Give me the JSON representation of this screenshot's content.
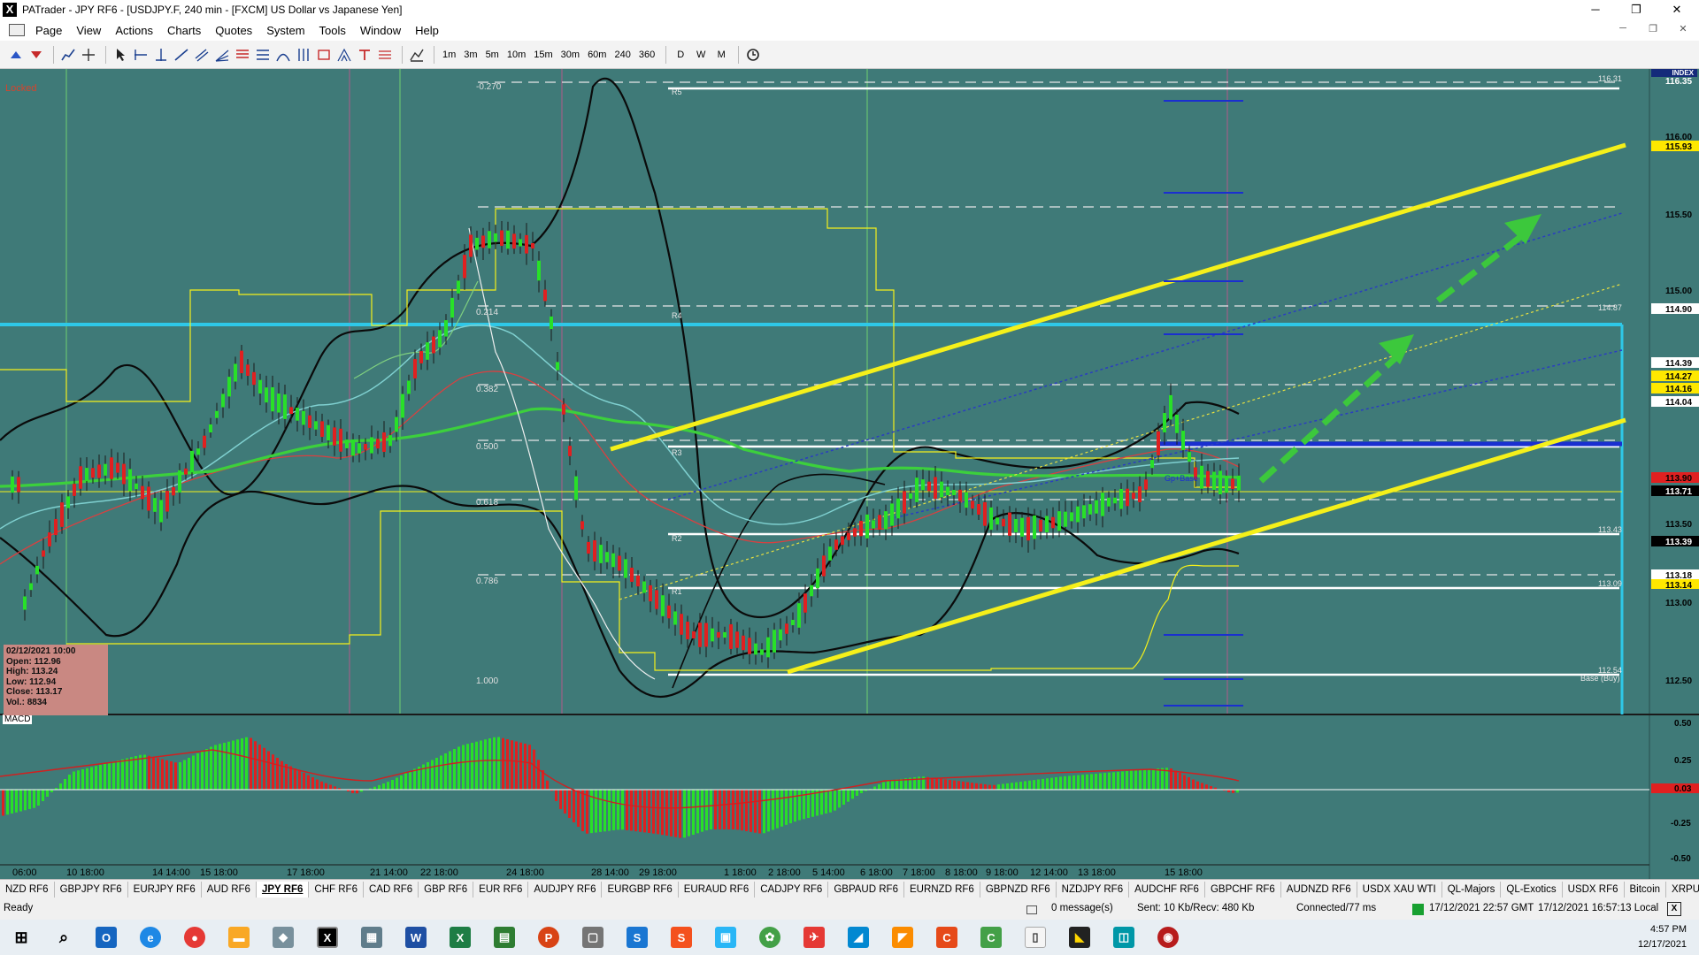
{
  "window": {
    "title": "PATrader - JPY RF6 - [USDJPY.F, 240 min - [FXCM] US Dollar vs Japanese Yen]",
    "minimize_glyph": "─",
    "maximize_glyph": "❐",
    "close_glyph": "✕"
  },
  "menu": [
    "Page",
    "View",
    "Actions",
    "Charts",
    "Quotes",
    "System",
    "Tools",
    "Window",
    "Help"
  ],
  "toolbar": {
    "timeframes": [
      "1m",
      "3m",
      "5m",
      "10m",
      "15m",
      "30m",
      "60m",
      "240",
      "360",
      "D",
      "W",
      "M"
    ]
  },
  "chart": {
    "locked_label": "Locked",
    "index_label": "INDEX",
    "macd_label": "MACD",
    "fib_levels": [
      {
        "label": "-0.270",
        "price": 116.31
      },
      {
        "label": "0.214",
        "price": 114.87
      },
      {
        "label": "0.382",
        "price": 114.38
      },
      {
        "label": "0.500",
        "price": 114.03
      },
      {
        "label": "0.618",
        "price": 113.68
      },
      {
        "label": "0.786",
        "price": 113.18
      },
      {
        "label": "1.000",
        "price": 112.54
      }
    ],
    "pivot_labels": [
      {
        "label": "R5",
        "price": 116.31
      },
      {
        "label": "R4",
        "price": 114.87
      },
      {
        "label": "R3",
        "price": 113.97
      },
      {
        "label": "R2",
        "price": 113.43
      },
      {
        "label": "R1",
        "price": 113.09
      },
      {
        "label": "Base (Buy)",
        "price": 112.54
      }
    ],
    "pivot_price_labels": [
      "116.31",
      "114.87",
      "113.43",
      "113.09",
      "112.54"
    ],
    "mid_label": "Gp+Base",
    "info_box": {
      "date": "02/12/2021 10:00",
      "open": "Open: 112.96",
      "high": "High: 113.24",
      "low": "Low: 112.94",
      "close": "Close: 113.17",
      "vol": "Vol.: 8834"
    },
    "price_axis": [
      "116.35",
      "116.00",
      "115.93",
      "115.50",
      "115.00",
      "114.90",
      "114.39",
      "114.27",
      "114.16",
      "114.04",
      "113.90",
      "113.71",
      "113.50",
      "113.39",
      "113.18",
      "113.14",
      "113.00",
      "112.50"
    ],
    "macd_axis": [
      "0.50",
      "0.25",
      "0.03",
      "-0.25",
      "-0.50"
    ],
    "time_axis": [
      "06:00",
      "10 18:00",
      "14 14:00",
      "15 18:00",
      "17 18:00",
      "21 14:00",
      "22 18:00",
      "24 18:00",
      "28 14:00",
      "29 18:00",
      "1 18:00",
      "2 18:00",
      "5 14:00",
      "6 18:00",
      "7 18:00",
      "8 18:00",
      "9 18:00",
      "12 14:00",
      "13 18:00",
      "15 18:00"
    ],
    "colors": {
      "background": "#3f7a78",
      "trend_channel": "#f5f01a",
      "forecast_arrows": "#3cc83c",
      "resistance_line": "#2ec8e8",
      "pivot_line": "#ffffff",
      "bull_candle": "#28e028",
      "bear_candle": "#e02020"
    }
  },
  "symbol_tabs": [
    "NZD RF6",
    "GBPJPY RF6",
    "EURJPY RF6",
    "AUD RF6",
    "JPY RF6",
    "CHF RF6",
    "CAD RF6",
    "GBP RF6",
    "EUR RF6",
    "AUDJPY RF6",
    "EURGBP RF6",
    "EURAUD RF6",
    "CADJPY RF6",
    "GBPAUD RF6",
    "EURNZD RF6",
    "GBPNZD RF6",
    "NZDJPY RF6",
    "AUDCHF RF6",
    "GBPCHF RF6",
    "AUDNZD RF6",
    "USDX XAU WTI",
    "QL-Majors",
    "QL-Exotics",
    "USDX RF6",
    "Bitcoin",
    "XRPUSDRF6"
  ],
  "active_tab": "JPY RF6",
  "status": {
    "ready": "Ready",
    "messages": "0 message(s)",
    "traffic": "Sent: 10 Kb/Recv: 480 Kb",
    "connection": "Connected/77 ms",
    "gmt_time": "17/12/2021 22:57 GMT",
    "local_time": "17/12/2021 16:57:13 Local"
  },
  "taskbar": {
    "time": "4:57 PM",
    "date": "12/17/2021"
  }
}
